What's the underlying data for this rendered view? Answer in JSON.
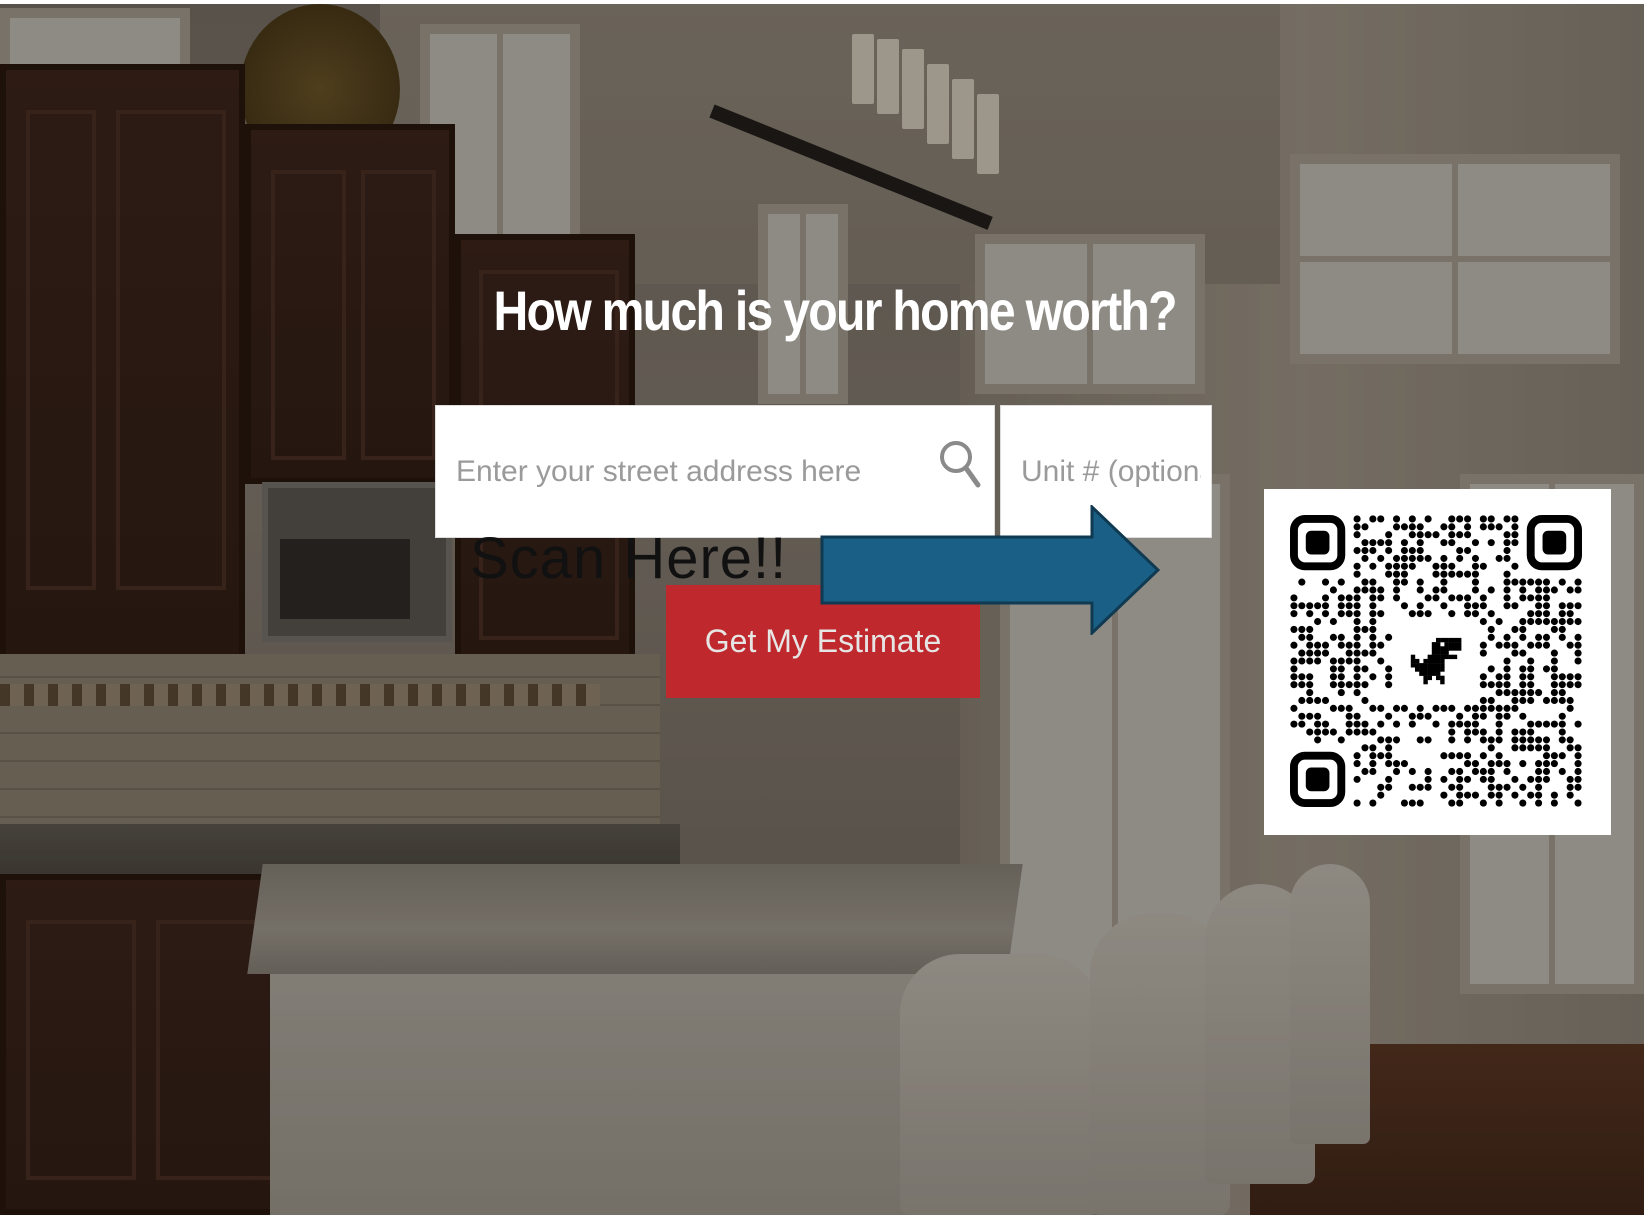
{
  "hero": {
    "headline": "How much is your home worth?"
  },
  "form": {
    "address_placeholder": "Enter your street address here",
    "unit_placeholder": "Unit # (optional)",
    "submit_label": "Get My Estimate"
  },
  "overlay": {
    "scan_text": "Scan Here!!",
    "arrow_color": "#1a5f86"
  },
  "colors": {
    "button": "#c8262b",
    "headline": "#ffffff"
  },
  "icons": {
    "search": "search-icon",
    "qr": "qr-code-icon",
    "dino": "dinosaur-icon"
  }
}
